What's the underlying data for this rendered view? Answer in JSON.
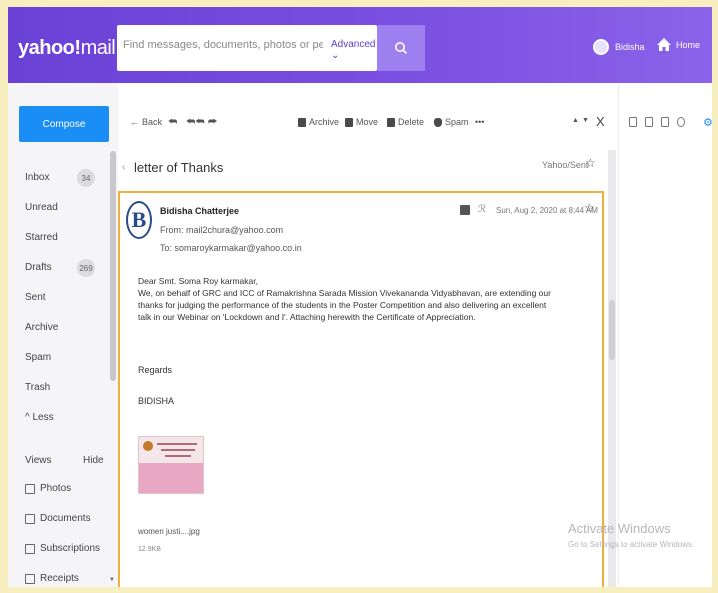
{
  "header": {
    "logo_main": "yahoo!",
    "logo_mail": "mail",
    "search_placeholder": "Find messages, documents, photos or people",
    "advanced_label": "Advanced",
    "user_name": "Bidisha",
    "home_label": "Home"
  },
  "sidebar": {
    "compose_label": "Compose",
    "folders": [
      {
        "label": "Inbox",
        "count": "34"
      },
      {
        "label": "Unread",
        "count": ""
      },
      {
        "label": "Starred",
        "count": ""
      },
      {
        "label": "Drafts",
        "count": "269"
      },
      {
        "label": "Sent",
        "count": ""
      },
      {
        "label": "Archive",
        "count": ""
      },
      {
        "label": "Spam",
        "count": ""
      },
      {
        "label": "Trash",
        "count": ""
      },
      {
        "label": "^ Less",
        "count": ""
      }
    ],
    "views_label": "Views",
    "hide_label": "Hide",
    "views": [
      "Photos",
      "Documents",
      "Subscriptions",
      "Receipts"
    ]
  },
  "toolbar": {
    "back": "Back",
    "archive": "Archive",
    "move": "Move",
    "delete": "Delete",
    "spam": "Spam",
    "more": "•••",
    "close": "X"
  },
  "message": {
    "subject": "letter of Thanks",
    "folder_path": "Yahoo/Sent",
    "sender_initial": "B",
    "sender_name": "Bidisha Chatterjee",
    "from": "From: mail2chura@yahoo.com",
    "to": "To: somaroykarmakar@yahoo.co.in",
    "date": "Sun, Aug 2, 2020 at 8:44 AM",
    "greeting": "Dear Smt. Soma Roy karmakar,",
    "body": "We, on behalf of GRC and ICC of Ramakrishna Sarada Mission Vivekananda Vidyabhavan, are extending our thanks for judging the performance of the students in the Poster Competition and also delivering an excellent talk in our Webinar on 'Lockdown and I'. Attaching herewith the Certificate of Appreciation.",
    "regards": "Regards",
    "signature": "BIDISHA",
    "attachment_name": "women justi....jpg",
    "attachment_size": "12.9KB"
  },
  "watermark": {
    "title": "Activate Windows",
    "subtitle": "Go to Settings to activate Windows."
  }
}
